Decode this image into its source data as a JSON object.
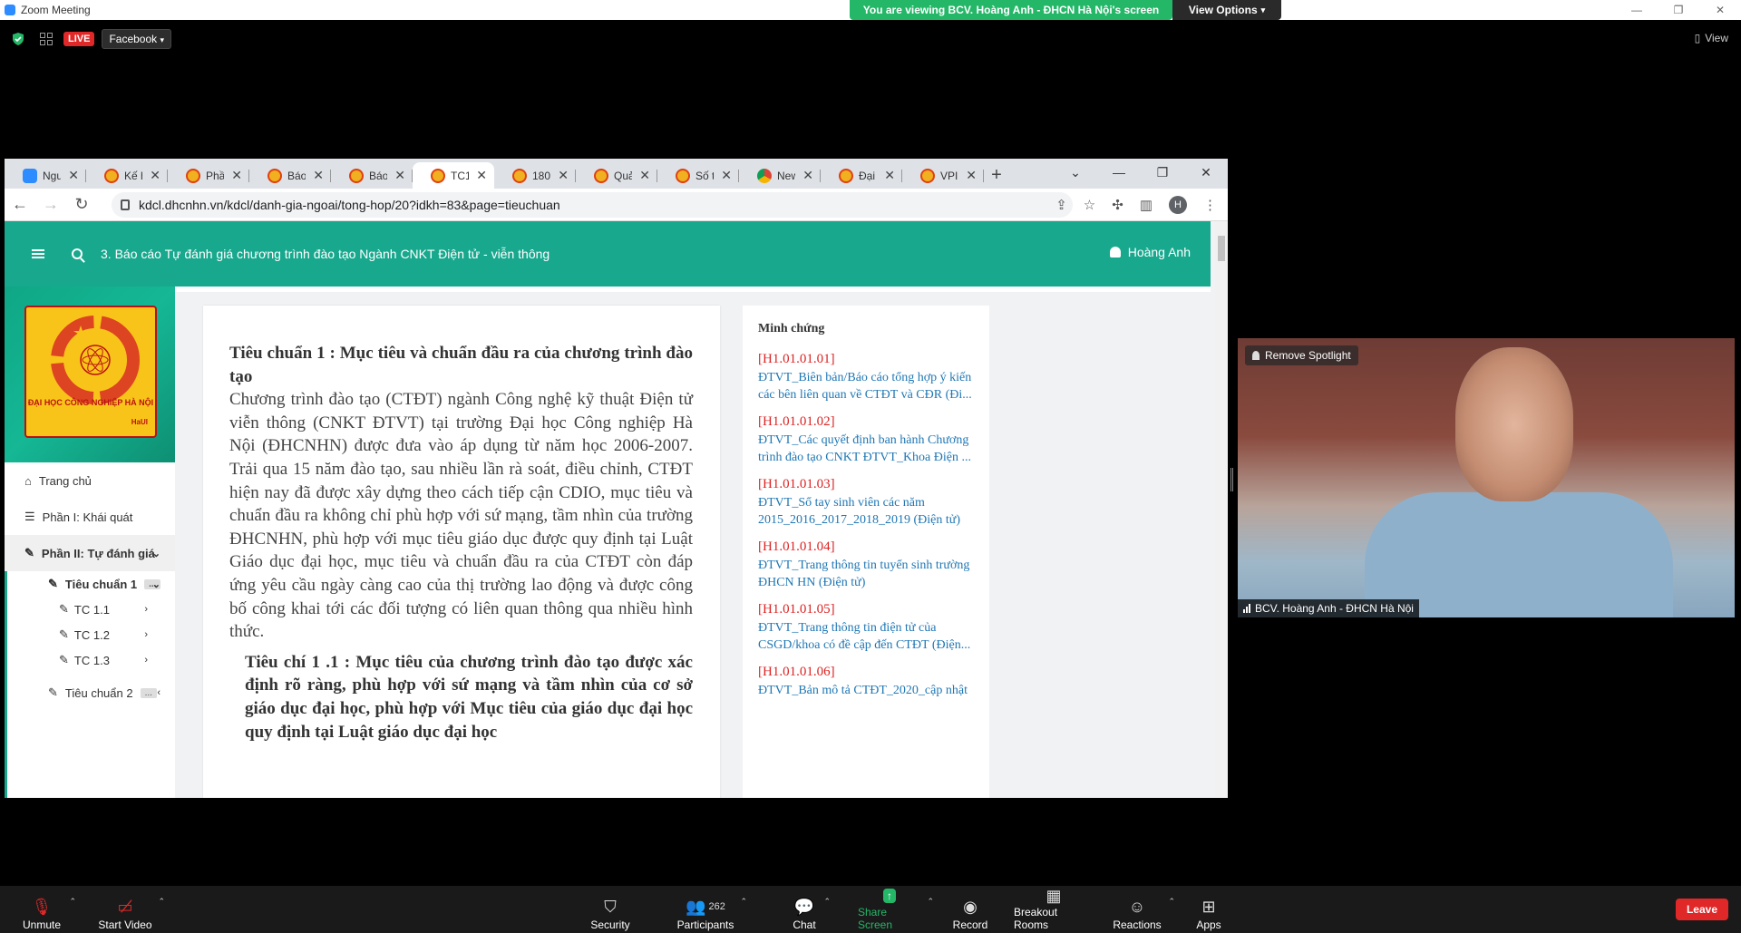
{
  "zoom": {
    "window_title": "Zoom Meeting",
    "viewing_banner": "You are viewing BCV. Hoàng Anh - ĐHCN Hà Nội's screen",
    "view_options": "View Options",
    "live_label": "LIVE",
    "stream_target": "Facebook",
    "view_label": "View",
    "spotlight_button": "Remove Spotlight",
    "participant_name": "BCV. Hoàng Anh - ĐHCN Hà Nội",
    "participants_count": "262",
    "toolbar": {
      "unmute": "Unmute",
      "start_video": "Start Video",
      "security": "Security",
      "participants": "Participants",
      "chat": "Chat",
      "share_screen": "Share Screen",
      "record": "Record",
      "breakout_rooms": "Breakout Rooms",
      "reactions": "Reactions",
      "apps": "Apps",
      "leave": "Leave"
    }
  },
  "browser": {
    "tabs": [
      {
        "label": "Ngư",
        "icon": "zoom-favicon"
      },
      {
        "label": "Kế h",
        "icon": "site-favicon"
      },
      {
        "label": "Phầ",
        "icon": "site-favicon"
      },
      {
        "label": "Báo",
        "icon": "site-favicon"
      },
      {
        "label": "Báo",
        "icon": "site-favicon"
      },
      {
        "label": "TC1",
        "icon": "site-favicon",
        "active": true
      },
      {
        "label": "180",
        "icon": "site-favicon"
      },
      {
        "label": "Quả",
        "icon": "site-favicon"
      },
      {
        "label": "Số t",
        "icon": "site-favicon"
      },
      {
        "label": "New",
        "icon": "chrome-favicon"
      },
      {
        "label": "Đại",
        "icon": "site-favicon"
      },
      {
        "label": "VPI",
        "icon": "site-favicon"
      }
    ],
    "url": "kdcl.dhcnhn.vn/kdcl/danh-gia-ngoai/tong-hop/20?idkh=83&page=tieuchuan",
    "profile_initial": "H"
  },
  "app": {
    "header_title": "3. Báo cáo Tự đánh giá chương trình đào tạo Ngành CNKT Điện tử - viễn thông",
    "user_name": "Hoàng Anh",
    "logo_text": "ĐẠI HỌC CÔNG NGHIỆP HÀ NỘI",
    "logo_sub": "HaUI",
    "nav": {
      "home": "Trang chủ",
      "part1": "Phần I: Khái quát",
      "part2": "Phần II: Tự đánh giá",
      "standard1": "Tiêu chuẩn 1",
      "tc11": "TC 1.1",
      "tc12": "TC 1.2",
      "tc13": "TC 1.3",
      "standard2": "Tiêu chuẩn 2",
      "dots": "..."
    },
    "content": {
      "heading": "Tiêu chuẩn 1 : Mục tiêu và chuẩn đầu ra của chương trình đào tạo",
      "body": "Chương trình đào tạo (CTĐT) ngành Công nghệ kỹ thuật Điện tử viễn thông (CNKT ĐTVT) tại trường Đại học Công nghiệp Hà Nội (ĐHCNHN) được đưa vào áp dụng từ năm học 2006-2007. Trải qua 15 năm đào tạo, sau nhiều lần rà soát, điều chỉnh, CTĐT hiện nay đã được xây dựng theo cách tiếp cận CDIO, mục tiêu và chuẩn đầu ra không chỉ phù hợp với sứ mạng, tầm nhìn của trường ĐHCNHN, phù hợp với mục tiêu giáo dục được quy định tại Luật Giáo dục đại học, mục tiêu và chuẩn đầu ra của CTĐT còn đáp ứng yêu cầu ngày càng cao của thị trường lao động và được công bố công khai tới các đối tượng có liên quan thông qua nhiều hình thức.",
      "criterion": "Tiêu chí 1 .1 : Mục tiêu của chương trình đào tạo được xác định rõ ràng, phù hợp với sứ mạng và tầm nhìn của cơ sở giáo dục đại học, phù hợp với Mục tiêu của giáo dục đại học quy định tại Luật giáo dục đại học"
    },
    "evidence": {
      "title": "Minh chứng",
      "items": [
        {
          "code": "[H1.01.01.01]",
          "line1": "ĐTVT_Biên bản/Báo cáo tổng hợp ý kiến",
          "line2": "các bên liên quan về CTĐT và CĐR (Đi..."
        },
        {
          "code": "[H1.01.01.02]",
          "line1": "ĐTVT_Các quyết định ban hành Chương",
          "line2": "trình đào tạo CNKT ĐTVT_Khoa Điện ..."
        },
        {
          "code": "[H1.01.01.03]",
          "line1": "ĐTVT_Sổ tay sinh viên các năm",
          "line2": "2015_2016_2017_2018_2019 (Điện tử)"
        },
        {
          "code": "[H1.01.01.04]",
          "line1": "ĐTVT_Trang thông tin tuyển sinh trường",
          "line2": "ĐHCN HN (Điện tử)"
        },
        {
          "code": "[H1.01.01.05]",
          "line1": "ĐTVT_Trang thông tin điện tử của",
          "line2": "CSGD/khoa có đề cập đến CTĐT (Điện..."
        },
        {
          "code": "[H1.01.01.06]",
          "line1": "ĐTVT_Bản mô tả CTĐT_2020_cập nhật",
          "line2": ""
        }
      ]
    }
  }
}
